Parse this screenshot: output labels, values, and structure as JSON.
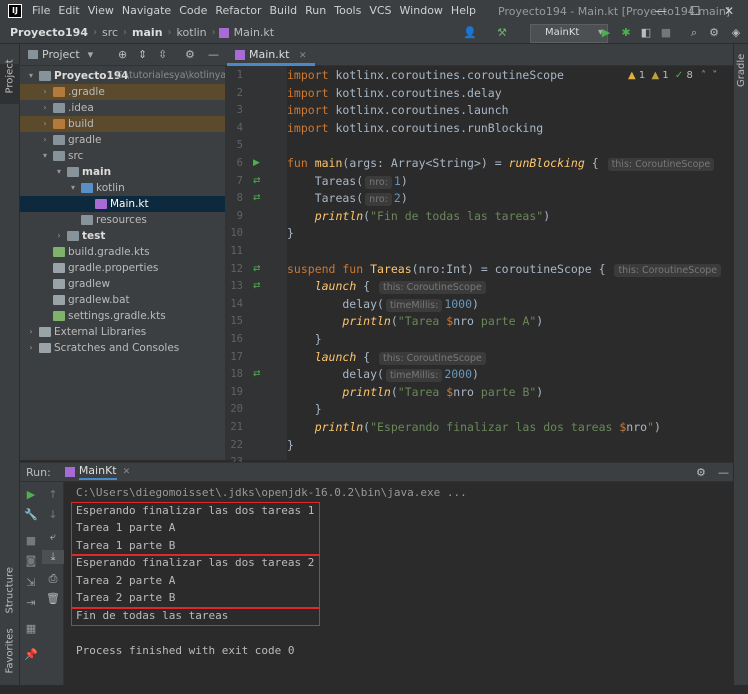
{
  "window": {
    "title": "Proyecto194 - Main.kt [Proyecto194.main]",
    "controls": [
      "—",
      "☐",
      "✕"
    ]
  },
  "menu": [
    "File",
    "Edit",
    "View",
    "Navigate",
    "Code",
    "Refactor",
    "Build",
    "Run",
    "Tools",
    "VCS",
    "Window",
    "Help"
  ],
  "breadcrumb": {
    "project": "Proyecto194",
    "path": [
      "src",
      "main",
      "kotlin"
    ],
    "file": "Main.kt"
  },
  "toolbar": {
    "run_config": "MainKt"
  },
  "left_strip": {
    "project_tab": "Project",
    "structure_tab": "Structure",
    "favorites_tab": "Favorites"
  },
  "right_strip": {
    "gradle_tab": "Gradle"
  },
  "project_panel": {
    "title": "Project",
    "tree": [
      {
        "label": "Proyecto194",
        "extra": "C:\\tutorialesya\\kotlinya\\Pr",
        "depth": 0,
        "arrow": "▾",
        "icon": "folder",
        "bold": true
      },
      {
        "label": ".gradle",
        "depth": 1,
        "arrow": "›",
        "icon": "folder-orange",
        "hl": true
      },
      {
        "label": ".idea",
        "depth": 1,
        "arrow": "›",
        "icon": "folder"
      },
      {
        "label": "build",
        "depth": 1,
        "arrow": "›",
        "icon": "folder-orange",
        "hl": true
      },
      {
        "label": "gradle",
        "depth": 1,
        "arrow": "›",
        "icon": "folder"
      },
      {
        "label": "src",
        "depth": 1,
        "arrow": "▾",
        "icon": "folder"
      },
      {
        "label": "main",
        "depth": 2,
        "arrow": "▾",
        "icon": "folder",
        "bold": true
      },
      {
        "label": "kotlin",
        "depth": 3,
        "arrow": "▾",
        "icon": "folder-blue"
      },
      {
        "label": "Main.kt",
        "depth": 4,
        "arrow": "",
        "icon": "file-k",
        "selected": true
      },
      {
        "label": "resources",
        "depth": 3,
        "arrow": "",
        "icon": "folder"
      },
      {
        "label": "test",
        "depth": 2,
        "arrow": "›",
        "icon": "folder",
        "bold": true
      },
      {
        "label": "build.gradle.kts",
        "depth": 1,
        "arrow": "",
        "icon": "file-g"
      },
      {
        "label": "gradle.properties",
        "depth": 1,
        "arrow": "",
        "icon": "file-t"
      },
      {
        "label": "gradlew",
        "depth": 1,
        "arrow": "",
        "icon": "file-t"
      },
      {
        "label": "gradlew.bat",
        "depth": 1,
        "arrow": "",
        "icon": "file-t"
      },
      {
        "label": "settings.gradle.kts",
        "depth": 1,
        "arrow": "",
        "icon": "file-g"
      },
      {
        "label": "External Libraries",
        "depth": 0,
        "arrow": "›",
        "icon": "file-t"
      },
      {
        "label": "Scratches and Consoles",
        "depth": 0,
        "arrow": "›",
        "icon": "file-t"
      }
    ]
  },
  "editor": {
    "tab": "Main.kt",
    "inspections": {
      "warnings": "1",
      "weak": "1",
      "ok": "8"
    },
    "line_numbers": [
      "1",
      "2",
      "3",
      "4",
      "5",
      "6",
      "7",
      "8",
      "9",
      "10",
      "11",
      "12",
      "13",
      "14",
      "15",
      "16",
      "17",
      "18",
      "19",
      "20",
      "21",
      "22",
      "23"
    ],
    "lines": [
      [
        [
          "kw",
          "import "
        ],
        [
          "",
          "kotlinx.coroutines.coroutineScope"
        ]
      ],
      [
        [
          "kw",
          "import "
        ],
        [
          "",
          "kotlinx.coroutines.delay"
        ]
      ],
      [
        [
          "kw",
          "import "
        ],
        [
          "",
          "kotlinx.coroutines.launch"
        ]
      ],
      [
        [
          "kw",
          "import "
        ],
        [
          "",
          "kotlinx.coroutines.runBlocking"
        ]
      ],
      [],
      [
        [
          "kw",
          "fun "
        ],
        [
          "fn",
          "main"
        ],
        [
          "",
          "("
        ],
        [
          "",
          "args"
        ],
        [
          "",
          ": Array<String>) = "
        ],
        [
          "fn italic",
          "runBlocking"
        ],
        [
          "",
          " { "
        ],
        [
          "hint",
          "this: CoroutineScope"
        ]
      ],
      [
        [
          "",
          "    Tareas("
        ],
        [
          "hint",
          "nro:"
        ],
        [
          "num",
          "1"
        ],
        [
          "",
          ")"
        ]
      ],
      [
        [
          "",
          "    Tareas("
        ],
        [
          "hint",
          "nro:"
        ],
        [
          "num",
          "2"
        ],
        [
          "",
          ")"
        ]
      ],
      [
        [
          "",
          "    "
        ],
        [
          "fn italic",
          "println"
        ],
        [
          "",
          "("
        ],
        [
          "str",
          "\"Fin de todas las tareas\""
        ],
        [
          "",
          ")"
        ]
      ],
      [
        [
          "",
          "}"
        ]
      ],
      [],
      [
        [
          "kw",
          "suspend fun "
        ],
        [
          "fn",
          "Tareas"
        ],
        [
          "",
          "(nro:Int) = coroutineScope { "
        ],
        [
          "hint",
          "this: CoroutineScope"
        ]
      ],
      [
        [
          "",
          "    "
        ],
        [
          "fn italic",
          "launch"
        ],
        [
          "",
          " { "
        ],
        [
          "hint",
          "this: CoroutineScope"
        ]
      ],
      [
        [
          "",
          "        delay("
        ],
        [
          "hint",
          "timeMillis:"
        ],
        [
          "num",
          "1000"
        ],
        [
          "",
          ")"
        ]
      ],
      [
        [
          "",
          "        "
        ],
        [
          "fn italic",
          "println"
        ],
        [
          "",
          "("
        ],
        [
          "str",
          "\"Tarea "
        ],
        [
          "kw",
          "$"
        ],
        [
          "",
          "nro"
        ],
        [
          "str",
          " parte A\""
        ],
        [
          "",
          ")"
        ]
      ],
      [
        [
          "",
          "    }"
        ]
      ],
      [
        [
          "",
          "    "
        ],
        [
          "fn italic",
          "launch"
        ],
        [
          "",
          " { "
        ],
        [
          "hint",
          "this: CoroutineScope"
        ]
      ],
      [
        [
          "",
          "        delay("
        ],
        [
          "hint",
          "timeMillis:"
        ],
        [
          "num",
          "2000"
        ],
        [
          "",
          ")"
        ]
      ],
      [
        [
          "",
          "        "
        ],
        [
          "fn italic",
          "println"
        ],
        [
          "",
          "("
        ],
        [
          "str",
          "\"Tarea "
        ],
        [
          "kw",
          "$"
        ],
        [
          "",
          "nro"
        ],
        [
          "str",
          " parte B\""
        ],
        [
          "",
          ")"
        ]
      ],
      [
        [
          "",
          "    }"
        ]
      ],
      [
        [
          "",
          "    "
        ],
        [
          "fn italic",
          "println"
        ],
        [
          "",
          "("
        ],
        [
          "str",
          "\"Esperando finalizar las dos tareas "
        ],
        [
          "kw",
          "$"
        ],
        [
          "",
          "nro"
        ],
        [
          "str",
          "\""
        ],
        [
          "",
          ")"
        ]
      ],
      [
        [
          "",
          "}"
        ]
      ],
      []
    ]
  },
  "run_panel": {
    "label": "Run:",
    "tab": "MainKt",
    "console": [
      "C:\\Users\\diegomoisset\\.jdks\\openjdk-16.0.2\\bin\\java.exe ...",
      "Esperando finalizar las dos tareas 1",
      "Tarea 1 parte A",
      "Tarea 1 parte B",
      "Esperando finalizar las dos tareas 2",
      "Tarea 2 parte A",
      "Tarea 2 parte B",
      "Fin de todas las tareas",
      "",
      "Process finished with exit code 0"
    ]
  },
  "colors": {
    "highlight_box": "#e02828",
    "selection": "#0d293e",
    "accent": "#4a88c7"
  }
}
